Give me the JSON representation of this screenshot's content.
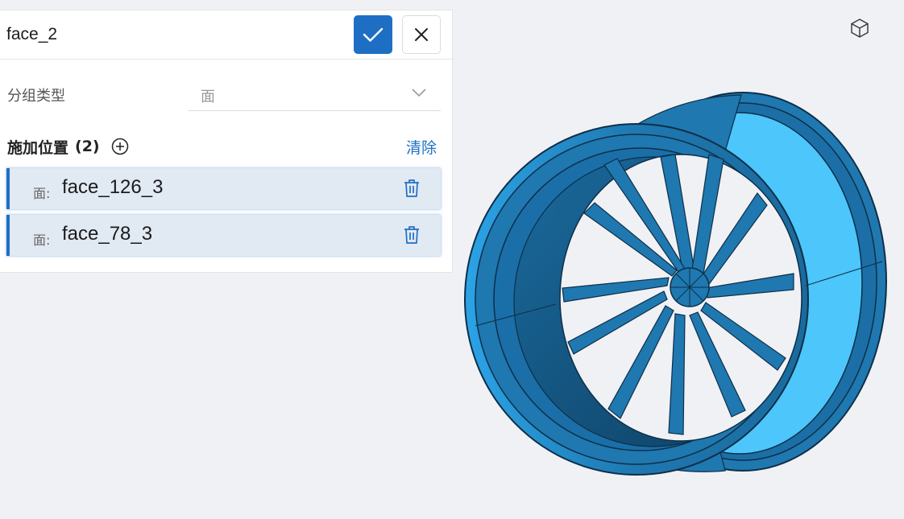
{
  "editor": {
    "name_value": "face_2",
    "confirm_icon": "check-icon",
    "cancel_icon": "close-icon"
  },
  "group_type": {
    "label": "分组类型",
    "value": "面",
    "chevron_icon": "chevron-down-icon"
  },
  "locations": {
    "title": "施加位置",
    "count": "(2)",
    "add_icon": "plus-circle-icon",
    "clear_label": "清除",
    "items": [
      {
        "prefix": "面:",
        "name": "face_126_3",
        "delete_icon": "trash-icon"
      },
      {
        "prefix": "面:",
        "name": "face_78_3",
        "delete_icon": "trash-icon"
      }
    ]
  },
  "viewer": {
    "view_cube_icon": "cube-icon",
    "colors": {
      "background": "#f0f1f5",
      "wheel_body": "#1f78b0",
      "wheel_dark": "#14557f",
      "highlight_face": "#4cc6fb",
      "accent": "#1e6fc4"
    }
  }
}
